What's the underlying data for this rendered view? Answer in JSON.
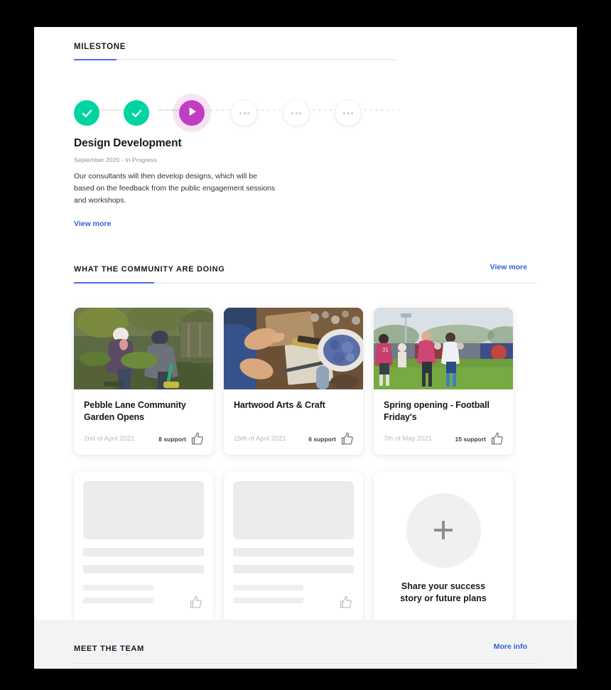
{
  "tabs": {
    "milestone_label": "MILESTONE"
  },
  "milestone": {
    "steps": [
      {
        "state": "done",
        "icon": "check-icon"
      },
      {
        "state": "done",
        "icon": "check-icon"
      },
      {
        "state": "active",
        "icon": "play-icon"
      },
      {
        "state": "pending",
        "icon": "ellipsis-icon"
      },
      {
        "state": "pending",
        "icon": "ellipsis-icon"
      },
      {
        "state": "pending",
        "icon": "ellipsis-icon"
      }
    ],
    "title": "Design Development",
    "meta": "September 2020 - In Progress",
    "description": "Our consultants will then develop designs, which will be based on the feedback from the public engagement sessions and workshops.",
    "view_more": "View more"
  },
  "community": {
    "heading": "WHAT THE COMMUNITY ARE DOING",
    "view_more": "View more",
    "cards": [
      {
        "title": "Pebble Lane Community Garden Opens",
        "date": "2nd of April 2021",
        "support": "8 support",
        "photo": "community-garden-photo"
      },
      {
        "title": "Hartwood Arts & Craft",
        "date": "15th of April 2021",
        "support": "6 support",
        "photo": "arts-and-craft-photo"
      },
      {
        "title": "Spring opening - Football Friday's",
        "date": "7th of May 2021",
        "support": "15 support",
        "photo": "football-match-photo"
      }
    ],
    "share": {
      "line1": "Share your success",
      "line2": "story or future plans"
    }
  },
  "footer": {
    "heading": "MEET THE TEAM",
    "more_info": "More info"
  },
  "colors": {
    "accent_blue": "#4a6cf0",
    "link_blue": "#2f5fdb",
    "done_green": "#00d4a0",
    "active_magenta": "#c13ec1",
    "footer_bg": "#f2f3f4",
    "skeleton_gray": "#ececec"
  }
}
